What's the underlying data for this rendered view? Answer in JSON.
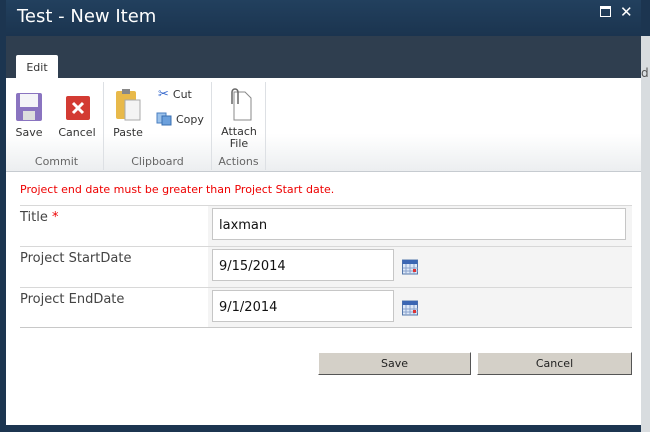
{
  "window": {
    "title": "Test - New Item",
    "page_bg_text": "d"
  },
  "ribbon": {
    "tab": "Edit",
    "groups": {
      "commit": "Commit",
      "clipboard": "Clipboard",
      "actions": "Actions"
    },
    "buttons": {
      "save": "Save",
      "cancel": "Cancel",
      "paste": "Paste",
      "cut": "Cut",
      "copy": "Copy",
      "attach1": "Attach",
      "attach2": "File"
    }
  },
  "form": {
    "error": "Project end date must be greater than Project Start date.",
    "fields": [
      {
        "label": "Title",
        "required": "*",
        "value": "laxman"
      },
      {
        "label": "Project StartDate",
        "value": "9/15/2014"
      },
      {
        "label": "Project EndDate",
        "value": "9/1/2014"
      }
    ],
    "save": "Save",
    "cancel": "Cancel"
  },
  "colors": {
    "error": "#e00000",
    "titlebar": "#1f3a56"
  }
}
